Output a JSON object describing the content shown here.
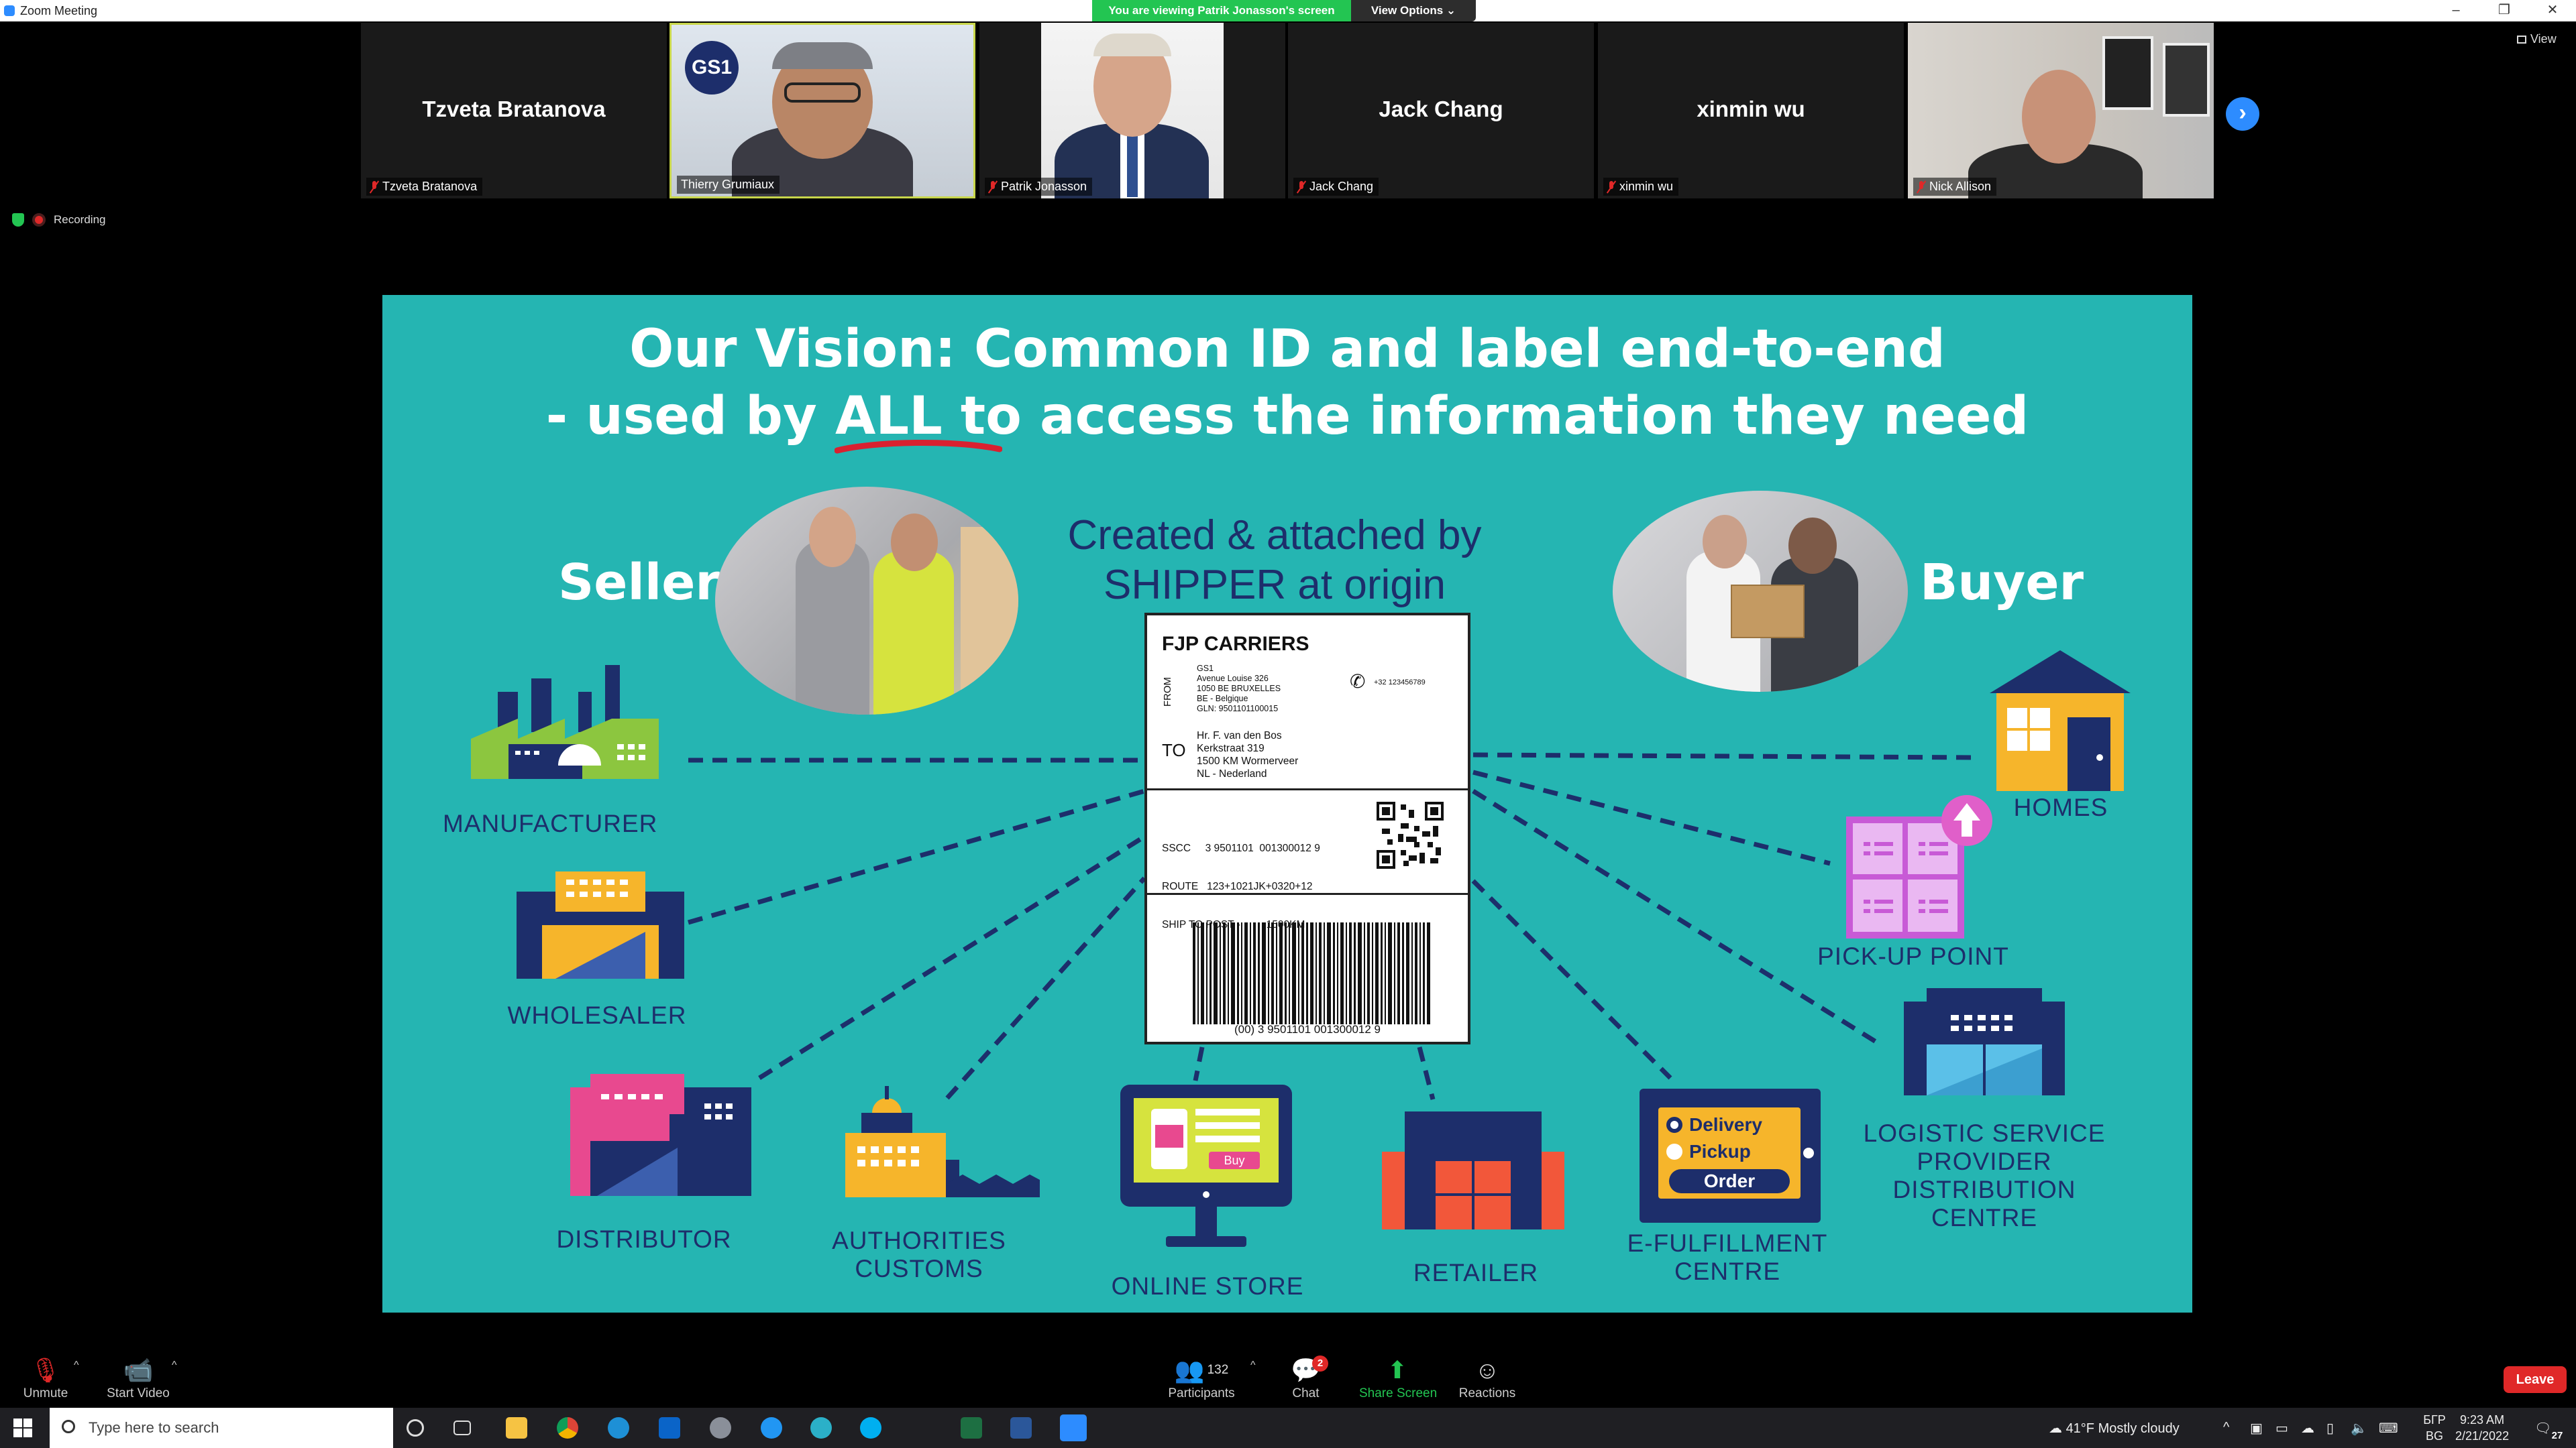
{
  "window": {
    "title": "Zoom Meeting",
    "controls": [
      "–",
      "❐",
      "✕"
    ]
  },
  "share_banner": {
    "viewing_text": "You are viewing Patrik Jonasson's screen",
    "view_options_label": "View Options ⌄"
  },
  "participants_strip": [
    {
      "display": "Tzveta Bratanova",
      "name": "Tzveta Bratanova",
      "video": false,
      "muted": true
    },
    {
      "display": "",
      "name": "Thierry Grumiaux",
      "video": true,
      "muted": false,
      "active_speaker": true
    },
    {
      "display": "",
      "name": "Patrik Jonasson",
      "video": true,
      "muted": true
    },
    {
      "display": "Jack Chang",
      "name": "Jack Chang",
      "video": false,
      "muted": true
    },
    {
      "display": "xinmin wu",
      "name": "xinmin wu",
      "video": false,
      "muted": true
    },
    {
      "display": "",
      "name": "Nick Allison",
      "video": true,
      "muted": true
    }
  ],
  "strip_next_icon": "chevron-right-icon",
  "view_button_label": "View",
  "recording_label": "Recording",
  "slide": {
    "headline_line1": "Our Vision: Common ID and label end-to-end",
    "headline_line2": "- used by ALL to access the information they need",
    "seller": "Seller",
    "buyer": "Buyer",
    "center_note_line1": "Created & attached by",
    "center_note_line2": "SHIPPER at origin",
    "label": {
      "carrier": "FJP CARRIERS",
      "from_label": "FROM",
      "from_lines": [
        "GS1",
        "Avenue Louise 326",
        "1050 BE BRUXELLES",
        "BE - Belgique",
        "GLN: 9501101100015"
      ],
      "phone": "+32 123456789",
      "to_label": "TO",
      "to_lines": [
        "Hr. F. van den Bos",
        "Kerkstraat 319",
        "1500 KM Wormerveer",
        "NL - Nederland"
      ],
      "sscc_lines": [
        "SSCC     3 9501101  001300012 9",
        "ROUTE   123+1021JK+0320+12",
        "SHIP TO POST -         1500KM"
      ],
      "barcode_text": "(00) 3 9501101 001300012 9"
    },
    "nodes": {
      "manufacturer": "MANUFACTURER",
      "wholesaler": "WHOLESALER",
      "distributor": "DISTRIBUTOR",
      "authorities_1": "AUTHORITIES",
      "authorities_2": "CUSTOMS",
      "online_store": "ONLINE STORE",
      "retailer": "RETAILER",
      "efulfillment_1": "E-FULFILLMENT",
      "efulfillment_2": "CENTRE",
      "logistic_1": "LOGISTIC SERVICE",
      "logistic_2": "PROVIDER",
      "logistic_3": "DISTRIBUTION CENTRE",
      "pickup": "PICK-UP POINT",
      "homes": "HOMES",
      "buy_button": "Buy",
      "ef_delivery": "Delivery",
      "ef_pickup": "Pickup",
      "ef_order": "Order"
    }
  },
  "controls": {
    "unmute": "Unmute",
    "start_video": "Start Video",
    "participants": "Participants",
    "participants_count": "132",
    "chat": "Chat",
    "chat_badge": "2",
    "share_screen": "Share Screen",
    "reactions": "Reactions",
    "leave": "Leave"
  },
  "taskbar": {
    "search_placeholder": "Type here to search",
    "weather": "41°F  Mostly cloudy",
    "lang_1": "БГР",
    "lang_2": "BG",
    "time": "9:23 AM",
    "date": "2/21/2022",
    "notif_count": "27"
  },
  "colors": {
    "slide_bg": "#25b5b2",
    "navy": "#1d2e6b",
    "zoom_blue": "#2d8cff",
    "leave_red": "#e02828",
    "share_green": "#23c552"
  }
}
